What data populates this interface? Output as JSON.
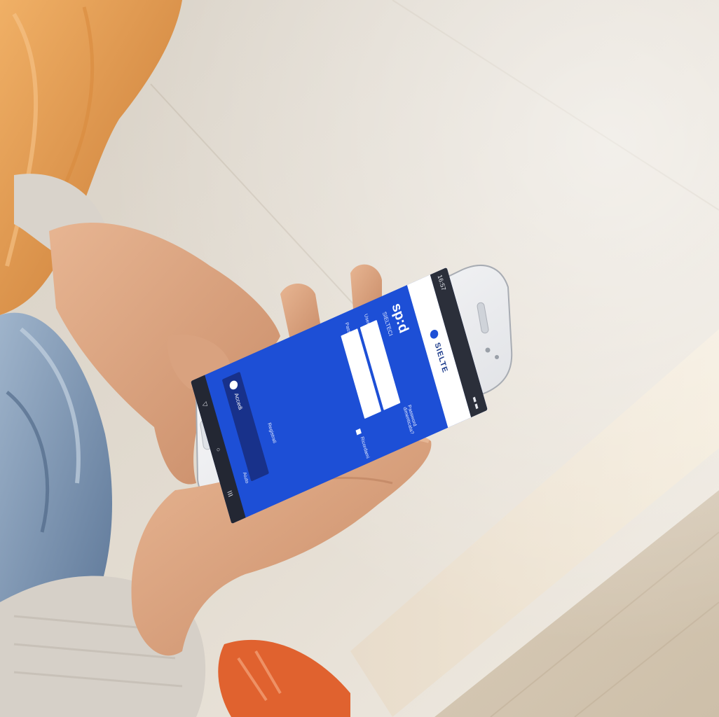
{
  "scene": {
    "colors": {
      "background": "#ffffff",
      "stone_light": "#e7e1d6",
      "stone_mid": "#cfc6b8",
      "skin": "#d8a27f",
      "skin_shadow": "#b97e5d",
      "hair": "#e8a35d",
      "denim": "#7b95b3",
      "sweater": "#d6d1ca",
      "shoe": "#e0622f",
      "phone_body": "#f2f3f5",
      "screen_blue": "#1d4fd6"
    }
  },
  "phone": {
    "status": {
      "time": "16:57"
    },
    "app": {
      "logo_text": "SIELTE",
      "brand": "sp:d",
      "brand_sub": "SIELTECI",
      "username_label": "Username",
      "password_label": "Password",
      "remember_label": "Ricordami",
      "forgot_password_link": "Password dimenticata?",
      "login_button_label": "Accedi",
      "register_link": "Registrati",
      "help_link": "Aiuto"
    },
    "nav": {
      "back_icon": "back-icon",
      "home_icon": "home-icon",
      "menu_icon": "menu-icon"
    }
  }
}
